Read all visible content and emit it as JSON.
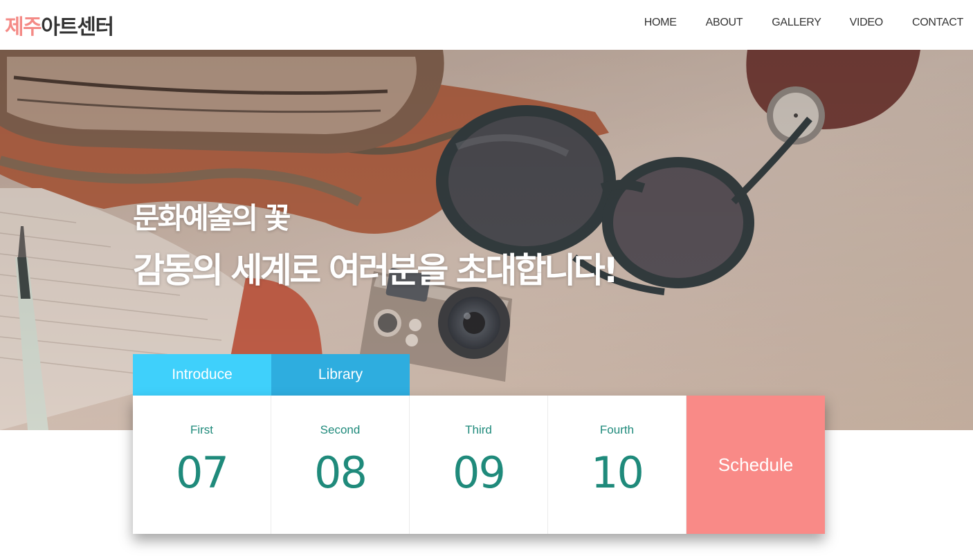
{
  "header": {
    "logo_part1": "제주",
    "logo_part2": "아트센터",
    "nav": [
      "HOME",
      "ABOUT",
      "GALLERY",
      "VIDEO",
      "CONTACT"
    ]
  },
  "hero": {
    "line1": "문화예술의 꽃",
    "line2": "감동의 세계로 여러분을 초대합니다!"
  },
  "tabs": [
    "Introduce",
    "Library"
  ],
  "schedule": {
    "items": [
      {
        "label": "First",
        "number": "07"
      },
      {
        "label": "Second",
        "number": "08"
      },
      {
        "label": "Third",
        "number": "09"
      },
      {
        "label": "Fourth",
        "number": "10"
      }
    ],
    "button": "Schedule"
  },
  "colors": {
    "logo_accent": "#f48a86",
    "tab_introduce": "#3fd0fb",
    "tab_library": "#2eaddf",
    "number_text": "#1f8a7b",
    "schedule_bg": "#f98a87"
  }
}
